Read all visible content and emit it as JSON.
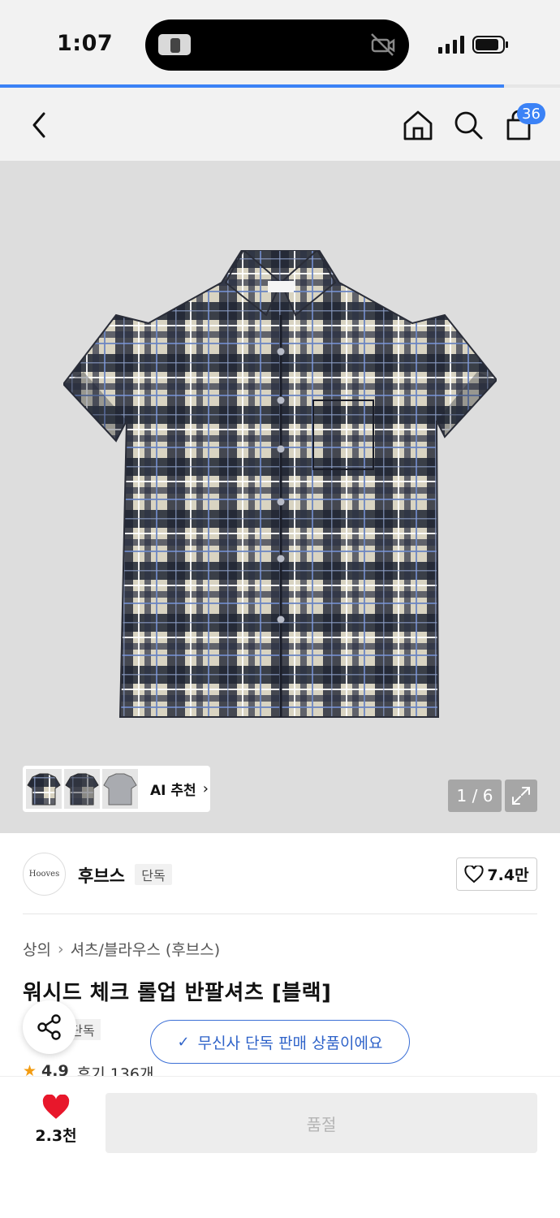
{
  "status_bar": {
    "time": "1:07",
    "page_progress": 0.9
  },
  "nav": {
    "back_icon": "chevron-left-icon",
    "home_icon": "home-icon",
    "search_icon": "search-icon",
    "cart_icon": "shopping-bag-icon",
    "cart_count": "36"
  },
  "gallery": {
    "ai_label": "AI 추천",
    "counter": "1 / 6",
    "expand_icon": "expand-icon"
  },
  "brand": {
    "logo_text": "Hooves",
    "name": "후브스",
    "exclusive_tag": "단독",
    "likes": "7.4만"
  },
  "product": {
    "breadcrumb": [
      "상의",
      "셔츠/블라우스 (후브스)"
    ],
    "title": "워시드 체크 롤업 반팔셔츠 [블랙]",
    "tag": "단독",
    "notice": "무신사 단독 판매 상품이에요",
    "rating": "4.9",
    "reviews": "후기 136개"
  },
  "bottom_bar": {
    "heart_count": "2.3천",
    "button_label": "품절"
  },
  "colors": {
    "accent": "#3b82f6",
    "heart": "#e8172b",
    "notice": "#2f63c9"
  }
}
